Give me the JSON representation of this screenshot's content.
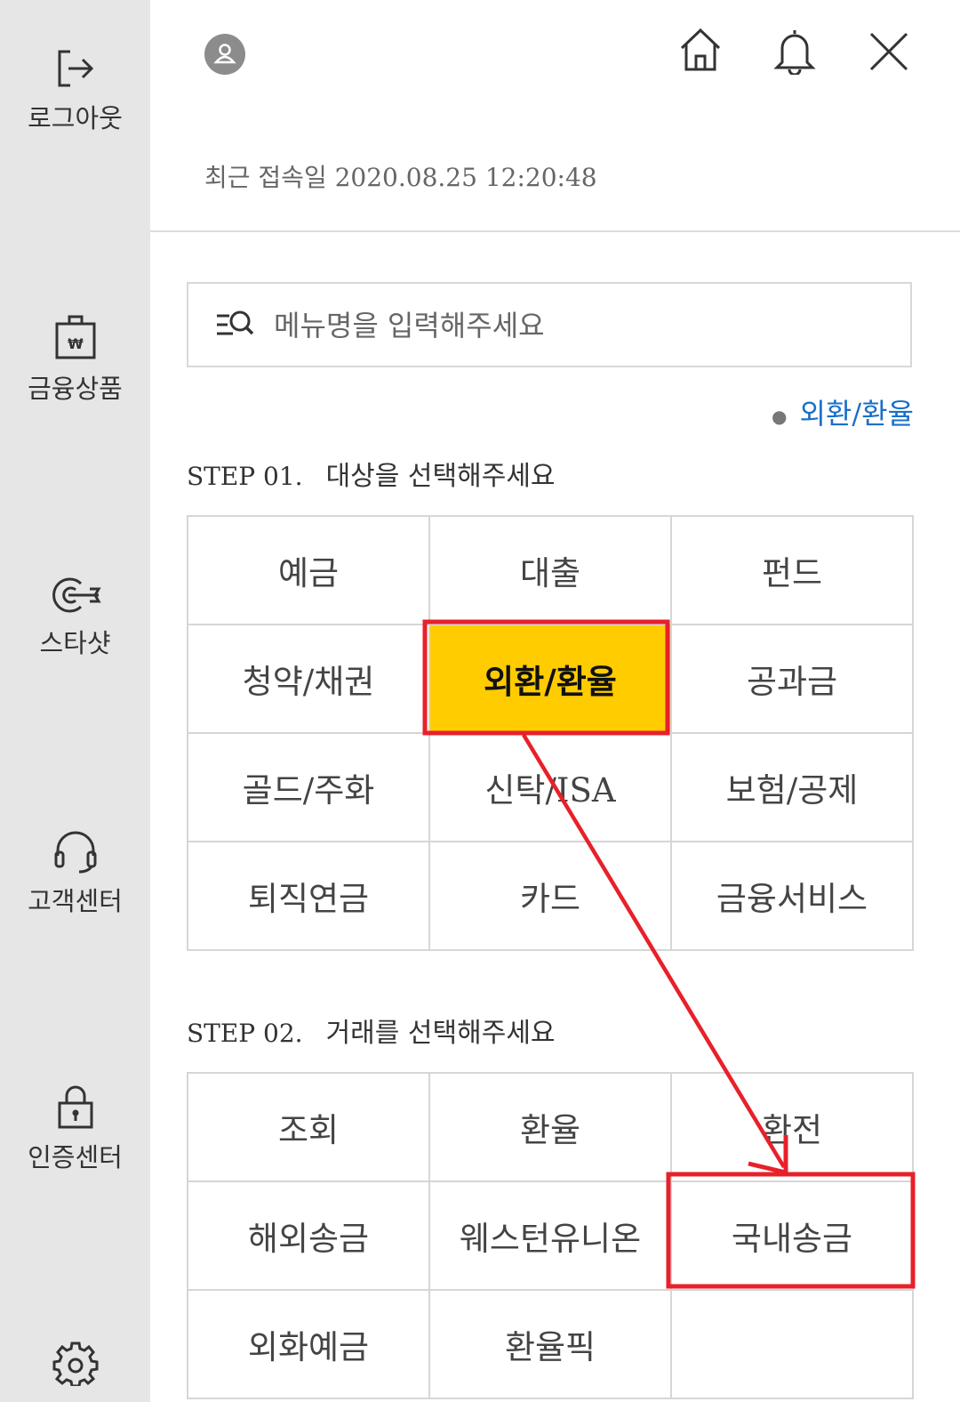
{
  "sidebar": {
    "items": [
      {
        "label": "로그아웃",
        "icon": "logout-icon"
      },
      {
        "label": "금융상품",
        "icon": "financial-product-bag-icon"
      },
      {
        "label": "스타샷",
        "icon": "starshot-target-icon"
      },
      {
        "label": "고객센터",
        "icon": "headset-icon"
      },
      {
        "label": "인증센터",
        "icon": "lock-icon"
      },
      {
        "label": "",
        "icon": "gear-icon"
      }
    ]
  },
  "header": {
    "last_login": "최근 접속일 2020.08.25 12:20:48",
    "icons": [
      "home-icon",
      "bell-icon",
      "close-icon"
    ]
  },
  "search": {
    "placeholder": "메뉴명을 입력해주세요"
  },
  "breadcrumb": {
    "current": "외환/환율"
  },
  "step1": {
    "number": "STEP 01.",
    "title": "대상을 선택해주세요",
    "items": [
      "예금",
      "대출",
      "펀드",
      "청약/채권",
      "외환/환율",
      "공과금",
      "골드/주화",
      "신탁/ISA",
      "보험/공제",
      "퇴직연금",
      "카드",
      "금융서비스"
    ],
    "selected": "외환/환율"
  },
  "step2": {
    "number": "STEP 02.",
    "title": "거래를 선택해주세요",
    "items": [
      "조회",
      "환율",
      "환전",
      "해외송금",
      "웨스턴유니온",
      "국내송금",
      "외화예금",
      "환율픽",
      ""
    ]
  },
  "colors": {
    "selected_bg": "#ffcc00",
    "sidebar_bg": "#e6e6e6",
    "link_blue": "#1a6fc9",
    "annotation_red": "#e8202a"
  }
}
